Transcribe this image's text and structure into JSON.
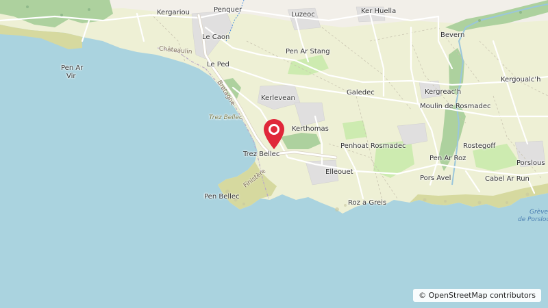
{
  "map": {
    "places": [
      {
        "id": "kergariou",
        "label": "Kergariou"
      },
      {
        "id": "penquer",
        "label": "Penquer"
      },
      {
        "id": "luzeoc",
        "label": "Luzeoc"
      },
      {
        "id": "ker-huella",
        "label": "Ker Huella"
      },
      {
        "id": "bevern",
        "label": "Bevern"
      },
      {
        "id": "le-caon",
        "label": "Le Caon"
      },
      {
        "id": "pen-ar-stang",
        "label": "Pen Ar Stang"
      },
      {
        "id": "le-ped",
        "label": "Le Ped"
      },
      {
        "id": "pen-ar-vir-1",
        "label": "Pen Ar"
      },
      {
        "id": "pen-ar-vir-2",
        "label": "Vir"
      },
      {
        "id": "galedec",
        "label": "Galedec"
      },
      {
        "id": "kergreach",
        "label": "Kergreac'h"
      },
      {
        "id": "kergoualch",
        "label": "Kergoualc'h"
      },
      {
        "id": "kerlevean",
        "label": "Kerlevean"
      },
      {
        "id": "moulin-de-rosmadec",
        "label": "Moulin de Rosmadec"
      },
      {
        "id": "kerthomas",
        "label": "Kerthomas"
      },
      {
        "id": "trez-bellec",
        "label": "Trez Bellec"
      },
      {
        "id": "penhoat-rosmadec",
        "label": "Penhoat Rosmadec"
      },
      {
        "id": "rostegoff",
        "label": "Rostegoff"
      },
      {
        "id": "pen-ar-roz",
        "label": "Pen Ar Roz"
      },
      {
        "id": "porslous",
        "label": "Porslous"
      },
      {
        "id": "elleouet",
        "label": "Elleouet"
      },
      {
        "id": "pors-avel",
        "label": "Pors Avel"
      },
      {
        "id": "cabel-ar-run",
        "label": "Cabel Ar Run"
      },
      {
        "id": "pen-bellec",
        "label": "Pen Bellec"
      },
      {
        "id": "roz-a-greis",
        "label": "Roz a Greis"
      }
    ],
    "beach_labels": [
      {
        "id": "trez-bellec-beach",
        "label": "Trez Bellec"
      }
    ],
    "water_labels": [
      {
        "id": "greve-1",
        "label": "Grève"
      },
      {
        "id": "greve-2",
        "label": "de Porslous"
      }
    ],
    "road_labels": [
      {
        "id": "chateaulin",
        "label": "Châteaulin"
      },
      {
        "id": "bretagne",
        "label": "Bretagne"
      },
      {
        "id": "finistere",
        "label": "Finistère"
      }
    ],
    "marker": {
      "name": "location-pin",
      "color": "#e0283a"
    },
    "colors": {
      "water": "#aad3df",
      "land": "#f2efe9",
      "farmland": "#eef0d5",
      "grass": "#cdebb0",
      "forest": "#add19e",
      "residential": "#e0dfdf"
    }
  },
  "attribution": "© OpenStreetMap contributors"
}
